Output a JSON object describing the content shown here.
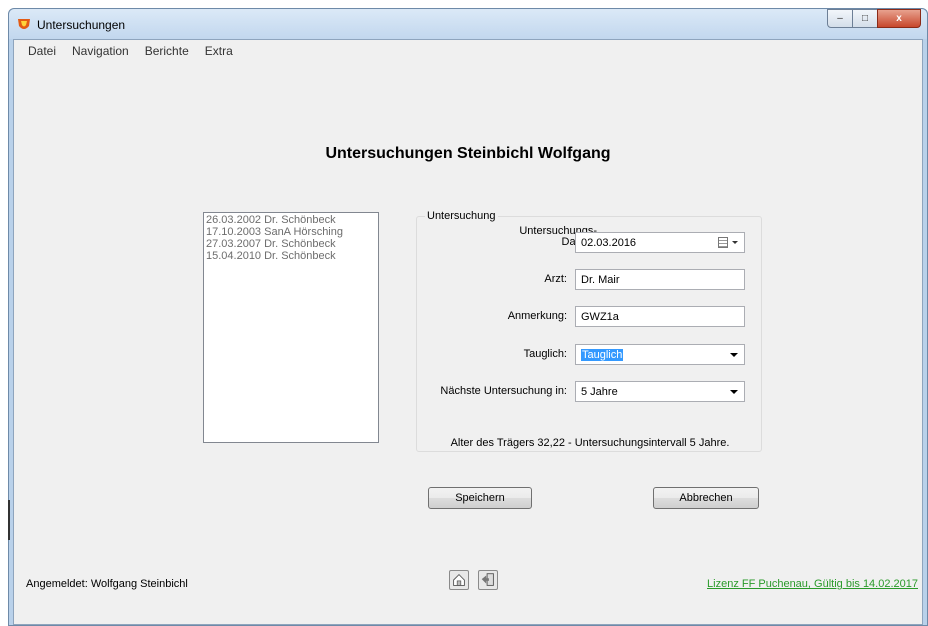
{
  "window": {
    "title": "Untersuchungen",
    "controls": {
      "minimize": "–",
      "maximize": "□",
      "close": "x"
    }
  },
  "menu": {
    "items": [
      "Datei",
      "Navigation",
      "Berichte",
      "Extra"
    ]
  },
  "page": {
    "heading": "Untersuchungen Steinbichl Wolfgang"
  },
  "history": {
    "items": [
      "26.03.2002 Dr. Schönbeck",
      "17.10.2003 SanA Hörsching",
      "27.03.2007 Dr. Schönbeck",
      "15.04.2010 Dr. Schönbeck"
    ]
  },
  "form": {
    "group_title": "Untersuchung",
    "date_label_line1": "Untersuchungs-",
    "date_label_line2": "Datum:",
    "date_value": "02.03.2016",
    "doctor_label": "Arzt:",
    "doctor_value": "Dr. Mair",
    "note_label": "Anmerkung:",
    "note_value": "GWZ1a",
    "fit_label": "Tauglich:",
    "fit_value": "Tauglich",
    "next_label": "Nächste Untersuchung in:",
    "next_value": "5 Jahre",
    "info": "Alter des Trägers 32,22 - Untersuchungsintervall 5 Jahre."
  },
  "buttons": {
    "save": "Speichern",
    "cancel": "Abbrechen"
  },
  "status": {
    "logged_in": "Angemeldet: Wolfgang Steinbichl",
    "license": "Lizenz FF Puchenau, Gültig bis 14.02.2017"
  },
  "colors": {
    "license_link": "#2a9a2a",
    "selection": "#3399ff",
    "frame": "#b9d1ea"
  }
}
